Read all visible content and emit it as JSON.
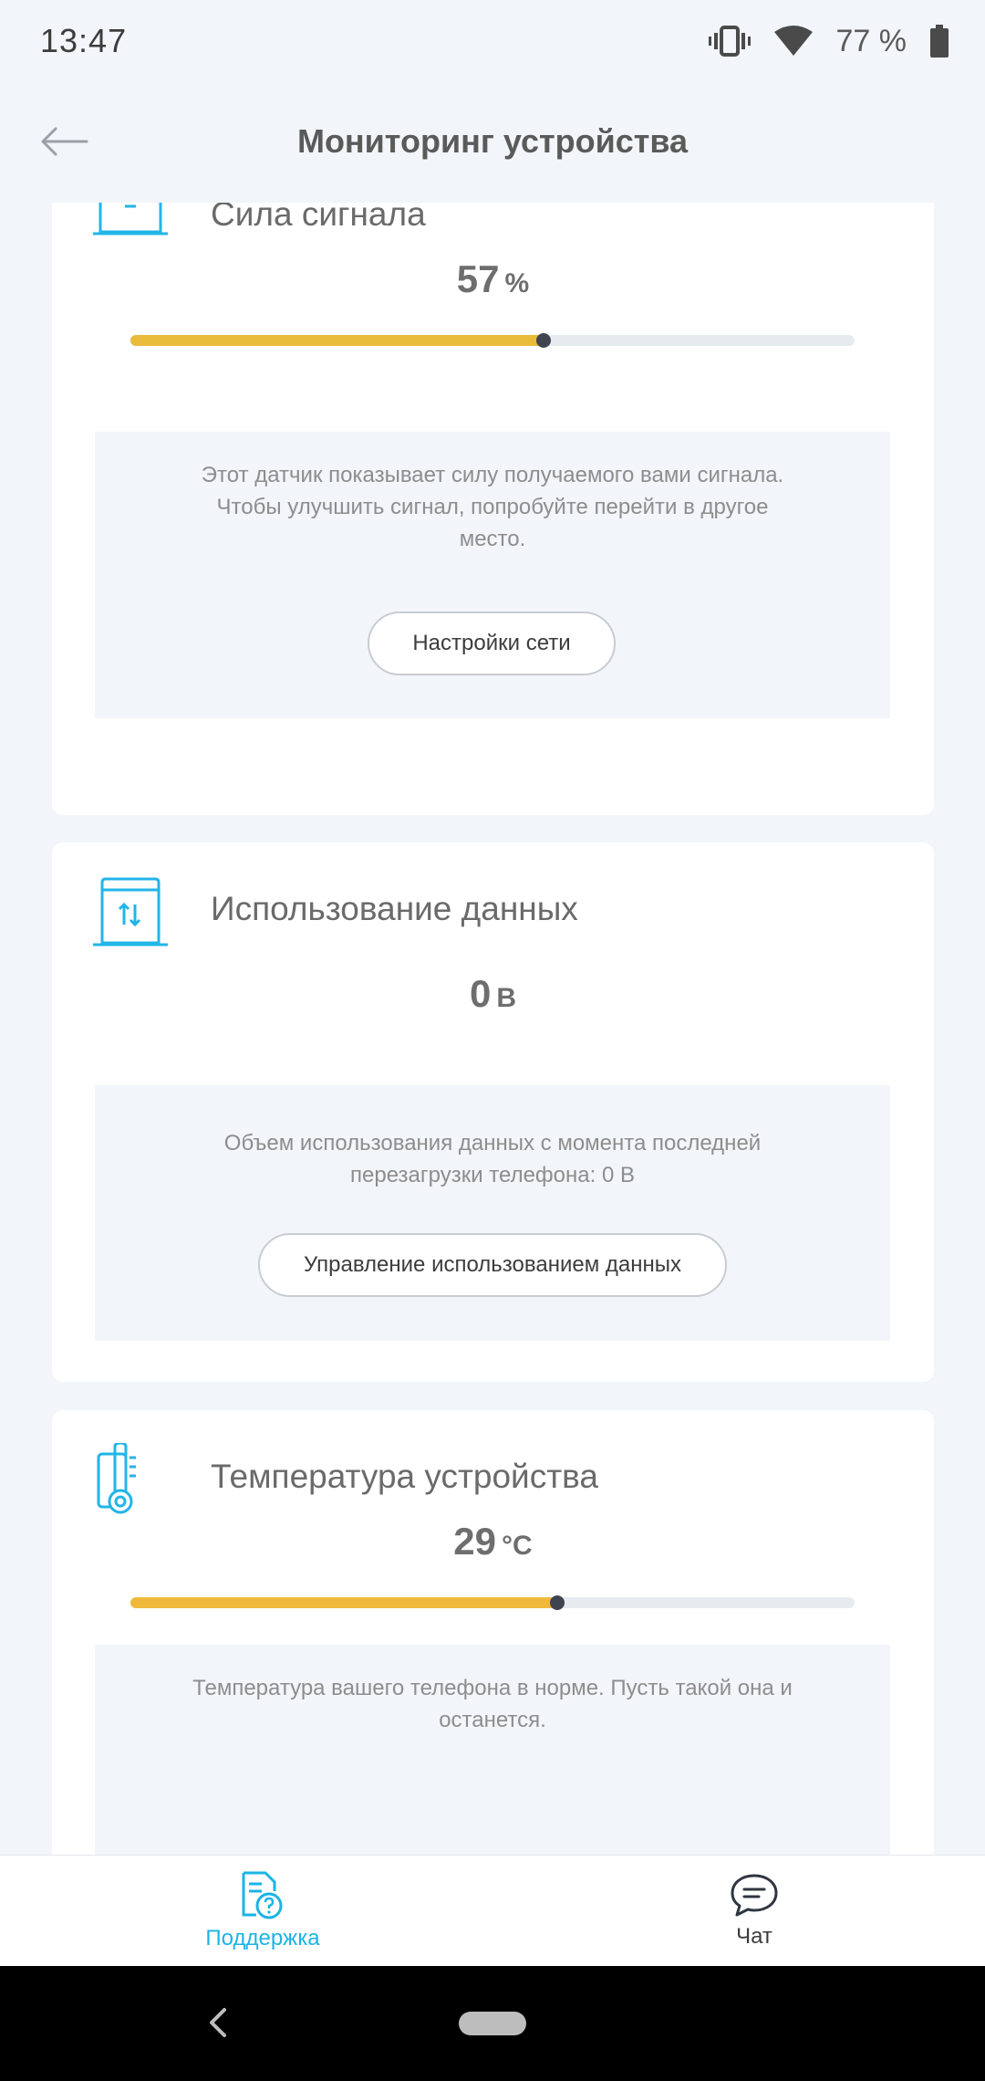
{
  "status_bar": {
    "time": "13:47",
    "battery": "77 %",
    "icons": [
      "vibrate-icon",
      "wifi-icon",
      "battery-icon"
    ]
  },
  "header": {
    "title": "Мониторинг устройства",
    "back_icon": "back-arrow-icon"
  },
  "cards": {
    "signal": {
      "icon": "router-icon",
      "title": "Сила сигнала",
      "value": "57",
      "unit": "%",
      "progress_percent": 57,
      "bar_color": "#e8bb3a",
      "info_line1": "Этот датчик показывает силу получаемого вами сигнала.",
      "info_line2": "Чтобы улучшить сигнал, попробуйте перейти в другое",
      "info_line3": "место.",
      "button": "Настройки сети"
    },
    "data": {
      "icon": "data-transfer-icon",
      "title": "Использование данных",
      "value": "0",
      "unit": "B",
      "info_line1": "Объем использования данных с момента последней",
      "info_line2": "перезагрузки телефона: 0 B",
      "button": "Управление использованием данных"
    },
    "temperature": {
      "icon": "thermometer-icon",
      "title": "Температура устройства",
      "value": "29",
      "unit": "°C",
      "progress_percent": 59,
      "bar_color": "#f0b93c",
      "info_line1": "Температура вашего телефона в норме. Пусть такой она и",
      "info_line2": "останется."
    }
  },
  "bottom_nav": {
    "support": "Поддержка",
    "chat": "Чат",
    "active_color": "#1ab4e6"
  }
}
